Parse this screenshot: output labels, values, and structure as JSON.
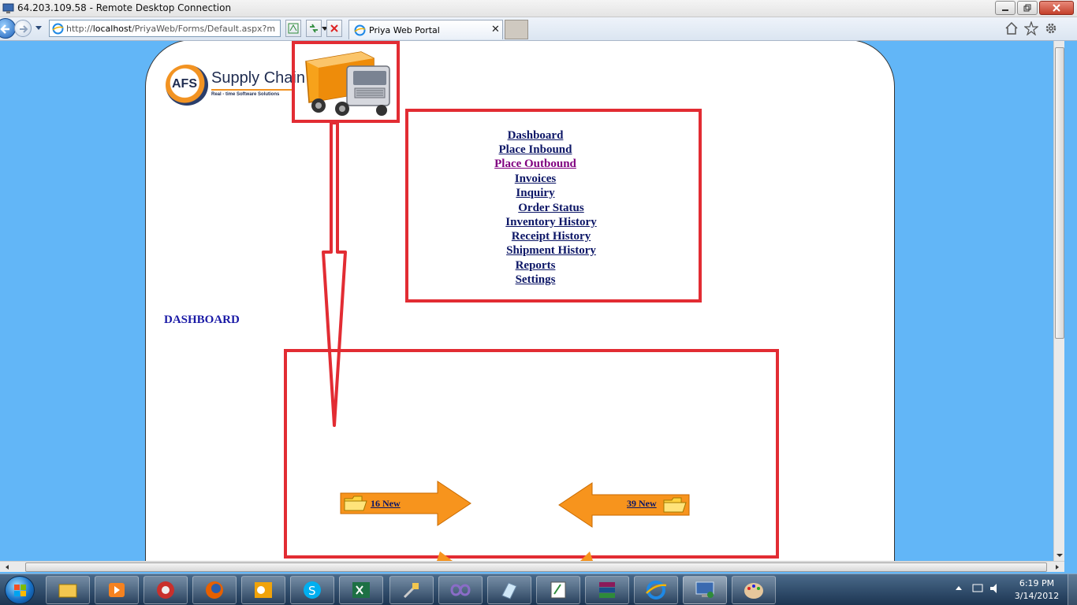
{
  "rdp": {
    "title": "64.203.109.58 - Remote Desktop Connection"
  },
  "browser": {
    "address": {
      "prefix": "http://",
      "host": "localhost",
      "path": "/PriyaWeb/Forms/Default.aspx?m"
    },
    "tab_label": "Priya Web Portal",
    "tab_close": "✕"
  },
  "logo": {
    "name": "Supply Chain",
    "badge": "AFS",
    "tagline": "Real - time Software Solutions"
  },
  "menu": {
    "items": [
      {
        "label": "Dashboard",
        "visited": false
      },
      {
        "label": "Place Inbound",
        "visited": false
      },
      {
        "label": "Place Outbound",
        "visited": true
      },
      {
        "label": "Invoices",
        "visited": false
      },
      {
        "label": "Inquiry",
        "visited": false
      },
      {
        "label": "Order Status",
        "visited": false
      },
      {
        "label": "Inventory History",
        "visited": false
      },
      {
        "label": "Receipt History",
        "visited": false
      },
      {
        "label": "Shipment History",
        "visited": false
      },
      {
        "label": "Reports",
        "visited": false
      },
      {
        "label": "Settings",
        "visited": false
      }
    ]
  },
  "dashboard": {
    "heading": "DASHBOARD",
    "inbound_new": "16 New",
    "outbound_new": "39 New"
  },
  "taskbar": {
    "clock_time": "6:19 PM",
    "clock_date": "3/14/2012"
  },
  "colors": {
    "annotation_red": "#e22c33",
    "arrow_orange": "#f7941d",
    "link_navy": "#0c1666",
    "visited_purple": "#800080"
  }
}
